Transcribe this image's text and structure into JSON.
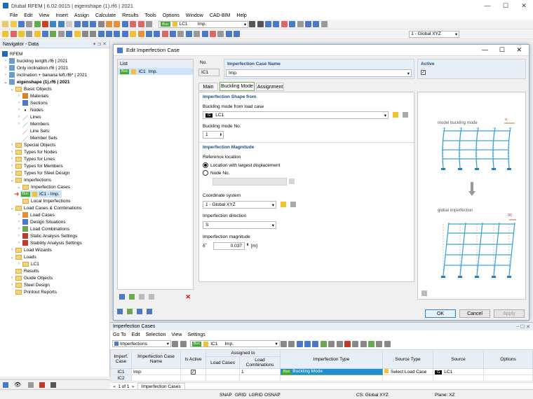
{
  "app": {
    "title": "Dlubal RFEM | 6.02.0015 | eigenshape (1).rf6 | 2021",
    "menus": [
      "File",
      "Edit",
      "View",
      "Insert",
      "Assign",
      "Calculate",
      "Results",
      "Tools",
      "Options",
      "Window",
      "CAD-BIM",
      "Help"
    ],
    "toolbar": {
      "badge": "Buc",
      "loadcase": "LC1",
      "loadcase_name": "Imp.",
      "coord_system": "1 - Global XYZ"
    }
  },
  "navigator": {
    "title": "Navigator - Data",
    "root": "RFEM",
    "items": [
      "buckling length.rf6 | 2021",
      "Only inclination.rf6 | 2021",
      "inclination + banana left.rf6* | 2021",
      "eigenshape (1).rf6 | 2021",
      "Basic Objects",
      "Materials",
      "Sections",
      "Nodes",
      "Lines",
      "Members",
      "Line Sets",
      "Member Sets",
      "Special Objects",
      "Types for Nodes",
      "Types for Lines",
      "Types for Members",
      "Types for Steel Design",
      "Imperfections",
      "Imperfection Cases",
      "IC1 - Imp.",
      "Local Imperfections",
      "Load Cases & Combinations",
      "Load Cases",
      "Design Situations",
      "Load Combinations",
      "Static Analysis Settings",
      "Stability Analysis Settings",
      "Load Wizards",
      "Loads",
      "LC1",
      "Results",
      "Guide Objects",
      "Steel Design",
      "Printout Reports"
    ],
    "badge": "Buc"
  },
  "dialog": {
    "title": "Edit Imperfection Case",
    "list_header": "List",
    "list_item_badge": "Buc",
    "list_item_no": "IC1",
    "list_item_name": "Imp.",
    "no_label": "No.",
    "no_value": "IC1",
    "name_label": "Imperfection Case Name",
    "name_value": "Imp.",
    "active_label": "Active",
    "tabs": [
      "Main",
      "Buckling Mode",
      "Assignment"
    ],
    "shape_section": "Imperfection Shape from",
    "buckling_mode_from_lc_label": "Buckling mode from load case",
    "lc_tag": "G",
    "lc_value": "LC1",
    "buckling_mode_no_label": "Buckling mode No.",
    "buckling_mode_no_value": "1",
    "magnitude_section": "Imperfection Magnitude",
    "reference_location_label": "Reference location",
    "radio_largest": "Location with largest displacement",
    "radio_node": "Node No.",
    "coord_system_label": "Coordinate system",
    "coord_system_value": "1 - Global XYZ",
    "direction_label": "Imperfection direction",
    "direction_value": "S",
    "magnitude_label": "Imperfection magnitude",
    "magnitude_symbol": "δ̃",
    "magnitude_value": "0.037",
    "magnitude_unit": "[m]",
    "preview_top_label": "model buckling mode",
    "preview_bottom_label": "global imperfection",
    "preview_top_dim": "u",
    "preview_bottom_dim": "δ0",
    "ok": "OK",
    "cancel": "Cancel",
    "apply": "Apply"
  },
  "table": {
    "title": "Imperfection Cases",
    "menus": [
      "Go To",
      "Edit",
      "Selection",
      "View",
      "Settings"
    ],
    "view_select": "Imperfections",
    "badge": "Buc",
    "lc": "IC1",
    "lc_name": "Imp.",
    "columns": {
      "case": "Imperf. Case",
      "name": "Imperfection Case Name",
      "active": "Is Active",
      "assigned": "Assigned to",
      "load_cases": "Load Cases",
      "load_combos": "Load Combinations",
      "type": "Imperfection Type",
      "source_type": "Source Type",
      "source": "Source",
      "options": "Options"
    },
    "rows": [
      {
        "case": "IC1",
        "name": "Imp.",
        "active": true,
        "load_cases": "",
        "load_combos": "1",
        "type_badge": "Buc",
        "type": "Buckling Mode",
        "source_type": "Select Load Case",
        "source_tag": "G",
        "source": "LC1",
        "options": ""
      },
      {
        "case": "IC2",
        "name": "",
        "active": false,
        "load_cases": "",
        "load_combos": "",
        "type_badge": "",
        "type": "",
        "source_type": "",
        "source_tag": "",
        "source": "",
        "options": ""
      }
    ],
    "pager": "1 of 1",
    "tab": "Imperfection Cases"
  },
  "status": {
    "snap": "SNAP",
    "grid": "GRID",
    "lgrid": "LGRID",
    "osnap": "OSNAP",
    "cs": "CS: Global XYZ",
    "plane": "Plane: XZ"
  }
}
